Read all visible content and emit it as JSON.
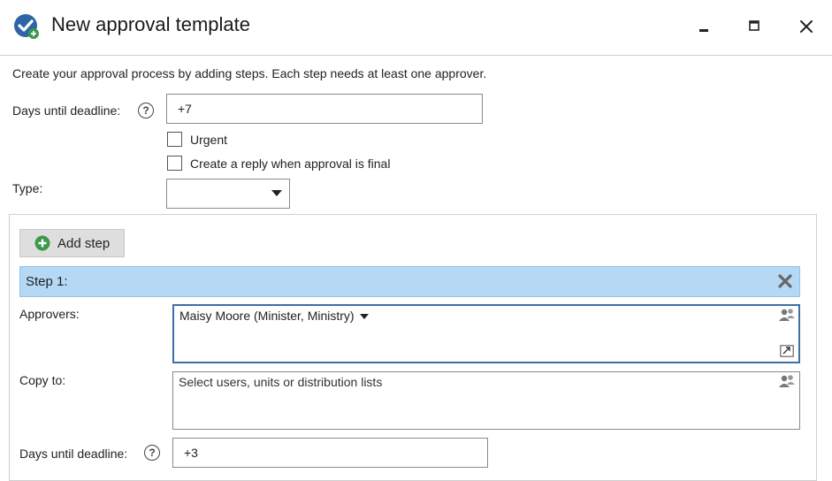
{
  "window": {
    "title": "New approval template",
    "icon": "check-badge-icon",
    "controls": [
      "minimize-icon",
      "maximize-icon",
      "close-icon"
    ]
  },
  "intro": "Create your approval process by adding steps. Each step needs at least one approver.",
  "days_until_deadline": {
    "label": "Days until deadline:",
    "value": "+7"
  },
  "urgent": {
    "label": "Urgent",
    "checked": false
  },
  "reply_when_final": {
    "label": "Create a reply when approval is final",
    "checked": false
  },
  "type": {
    "label": "Type:",
    "value": ""
  },
  "add_step": {
    "label": "Add step"
  },
  "steps": [
    {
      "title": "Step 1:",
      "approvers": {
        "label": "Approvers:",
        "value": "Maisy Moore (Minister, Ministry)"
      },
      "copy_to": {
        "label": "Copy to:",
        "placeholder": "Select users, units or distribution lists"
      },
      "days_until_deadline": {
        "label": "Days until deadline:",
        "value": "+3"
      }
    }
  ],
  "colors": {
    "accent": "#3d6fa8",
    "step_bar": "#b5d9f5",
    "add_button": "#dedede"
  }
}
